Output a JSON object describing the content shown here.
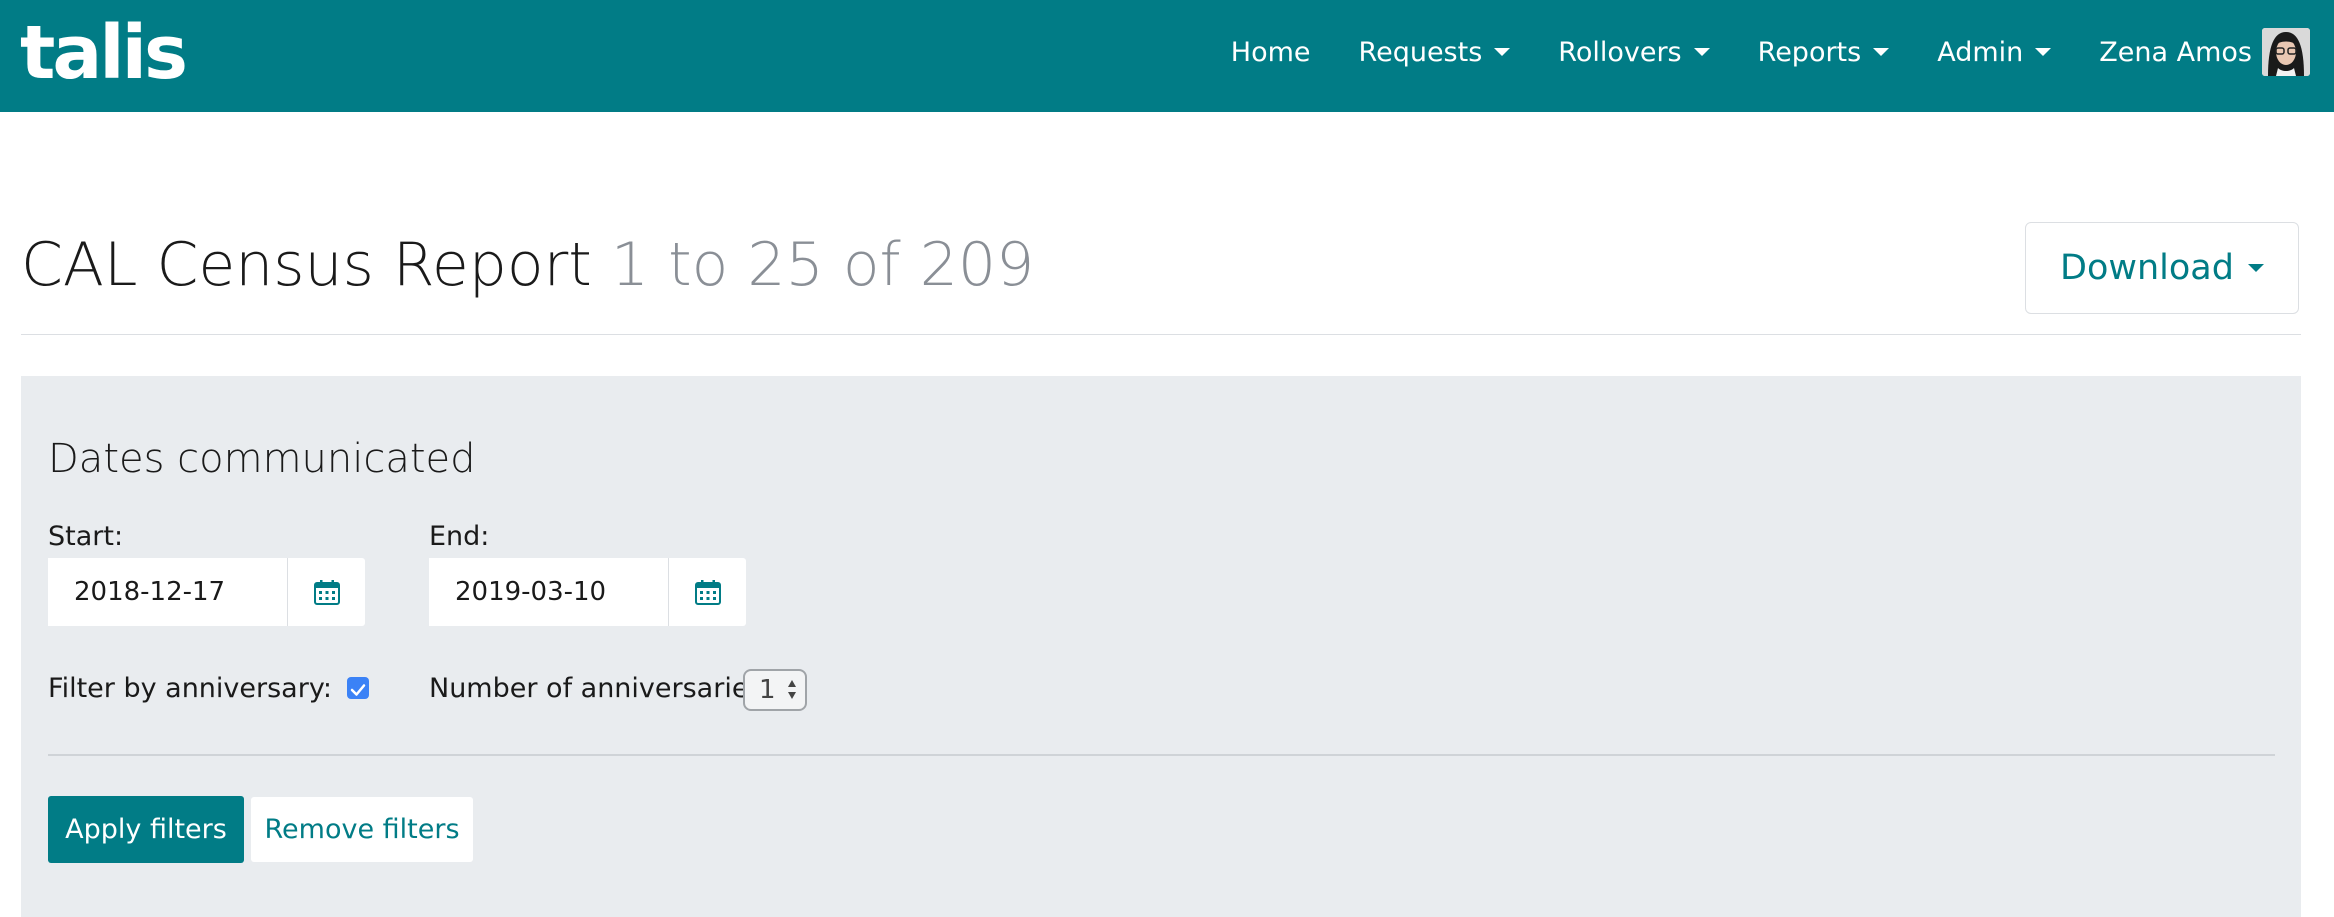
{
  "nav": {
    "logo": "talis",
    "items": [
      {
        "label": "Home",
        "dropdown": false
      },
      {
        "label": "Requests",
        "dropdown": true
      },
      {
        "label": "Rollovers",
        "dropdown": true
      },
      {
        "label": "Reports",
        "dropdown": true
      },
      {
        "label": "Admin",
        "dropdown": true
      }
    ],
    "user_name": "Zena Amos"
  },
  "header": {
    "title": "CAL Census Report",
    "count": "1 to 25 of 209",
    "download_label": "Download"
  },
  "filters": {
    "heading": "Dates communicated",
    "start_label": "Start:",
    "start_value": "2018-12-17",
    "end_label": "End:",
    "end_value": "2019-03-10",
    "anniversary_label": "Filter by anniversary:",
    "anniversary_checked": true,
    "num_anniversaries_label": "Number of anniversaries:",
    "num_anniversaries_value": "1",
    "apply_label": "Apply filters",
    "remove_label": "Remove filters"
  },
  "colors": {
    "brand": "#017c86",
    "panel_bg": "#e9ecef",
    "checkbox": "#3b82f6"
  },
  "icons": {
    "calendar": "calendar-icon",
    "caret": "caret-down-icon",
    "checkmark": "checkmark-icon"
  }
}
